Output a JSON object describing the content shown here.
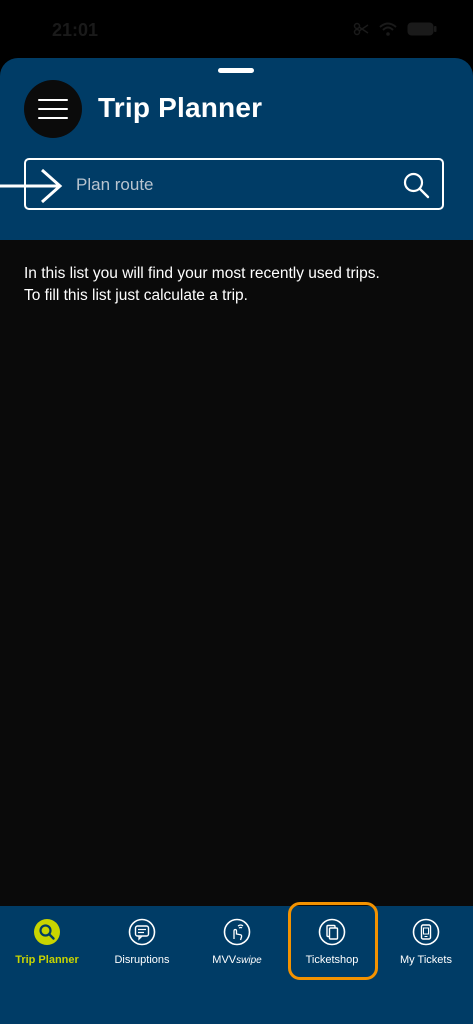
{
  "status_bar": {
    "time": "21:01",
    "icons": [
      "scissors-icon",
      "wifi-icon",
      "battery-icon"
    ],
    "battery": "100"
  },
  "header": {
    "title": "Trip Planner",
    "search_placeholder": "Plan route"
  },
  "main": {
    "info_line1": "In this list you will find your most recently used trips.",
    "info_line2": "To fill this list just calculate a trip."
  },
  "tabbar": {
    "tabs": [
      {
        "label": "Trip Planner",
        "icon": "search-icon",
        "active": true
      },
      {
        "label": "Disruptions",
        "icon": "speech-bubble-icon",
        "active": false
      },
      {
        "label": "MVV",
        "label_suffix": "swipe",
        "icon": "swipe-hand-icon",
        "active": false
      },
      {
        "label": "Ticketshop",
        "icon": "ticketshop-icon",
        "active": false
      },
      {
        "label": "My Tickets",
        "icon": "ticket-phone-icon",
        "active": false
      }
    ]
  },
  "colors": {
    "header_blue": "#003c66",
    "active_tab": "#c8d400",
    "highlight": "#f39200"
  }
}
